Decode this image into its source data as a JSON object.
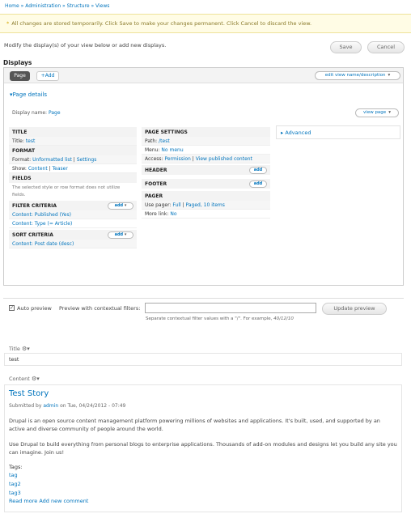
{
  "breadcrumb": {
    "home": "Home",
    "sep1": " » ",
    "admin": "Administration",
    "sep2": " » ",
    "structure": "Structure",
    "sep3": " » ",
    "views": "Views"
  },
  "message": {
    "icon": "*",
    "text": "All changes are stored temporarily. Click Save to make your changes permanent. Click Cancel to discard the view."
  },
  "intro": "Modify the display(s) of your view below or add new displays.",
  "buttons": {
    "save": "Save",
    "cancel": "Cancel"
  },
  "displays": {
    "heading": "Displays",
    "tab_page": "Page",
    "tab_add": "+Add",
    "edit_view": "edit view name/description",
    "details_toggle": "Page details",
    "display_name_label": "Display name:",
    "display_name_value": "Page",
    "view_page": "view page"
  },
  "left": {
    "title_head": "TITLE",
    "title_label": "Title:",
    "title_value": "test",
    "format_head": "FORMAT",
    "format_label": "Format:",
    "format_value": "Unformatted list",
    "format_sep": " | ",
    "format_settings": "Settings",
    "show_label": "Show:",
    "show_value": "Content",
    "show_sep": " | ",
    "show_teaser": "Teaser",
    "fields_head": "FIELDS",
    "fields_note": "The selected style or row format does not utilize fields.",
    "filter_head": "FILTER CRITERIA",
    "filter_add": "add",
    "filter_1": "Content: Published (Yes)",
    "filter_2": "Content: Type (= Article)",
    "sort_head": "SORT CRITERIA",
    "sort_add": "add",
    "sort_1": "Content: Post date (desc)"
  },
  "middle": {
    "settings_head": "PAGE SETTINGS",
    "path_label": "Path:",
    "path_value": "/test",
    "menu_label": "Menu:",
    "menu_value": "No menu",
    "access_label": "Access:",
    "access_value": "Permission",
    "access_sep": " | ",
    "access_extra": "View published content",
    "header_head": "HEADER",
    "header_add": "add",
    "footer_head": "FOOTER",
    "footer_add": "add",
    "pager_head": "PAGER",
    "pager_label": "Use pager:",
    "pager_value": "Full",
    "pager_sep": " | ",
    "pager_extra": "Paged, 10 items",
    "more_label": "More link:",
    "more_value": "No"
  },
  "right": {
    "advanced": "Advanced"
  },
  "preview": {
    "auto_label": "Auto preview",
    "auto_checked": true,
    "contextual_label": "Preview with contextual filters:",
    "contextual_value": "",
    "desc_prefix": "Separate contextual filter values with a \"/\". For example,",
    "desc_example": "40/12/10",
    "update": "Update preview"
  },
  "title_field": {
    "label": "Title",
    "value": "test"
  },
  "content_field": {
    "label": "Content"
  },
  "story": {
    "title": "Test Story",
    "submitted_prefix": "Submitted by",
    "author": "admin",
    "date": "on Tue, 04/24/2012 - 07:49",
    "para1": "Drupal is an open source content management platform powering millions of websites and applications. It's built, used, and supported by an active and diverse community of people around the world.",
    "para2": "Use Drupal to build everything from personal blogs to enterprise applications. Thousands of add-on modules and designs let you build any site you can imagine. Join us!",
    "tags_label": "Tags:",
    "tags": [
      "tag",
      "tag2",
      "tag3"
    ],
    "read_more": "Read more",
    "add_comment": "Add new comment"
  },
  "colors": {
    "link": "#0074bd",
    "message_bg": "#fffce5",
    "tab_active": "#555555"
  }
}
